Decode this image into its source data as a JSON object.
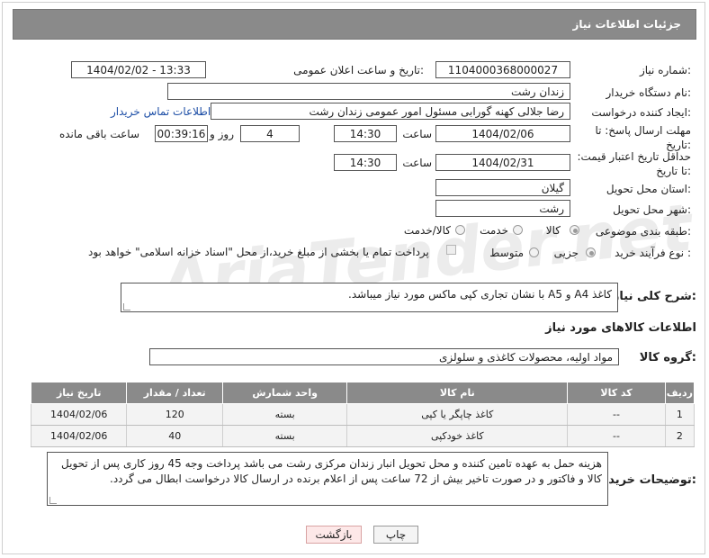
{
  "header": {
    "title": "جزئیات اطلاعات نیاز"
  },
  "fields": {
    "need_number_label": "شماره نیاز:",
    "need_number": "1104000368000027",
    "announce_label": "تاریخ و ساعت اعلان عمومی:",
    "announce_value": "1404/02/02 - 13:33",
    "buyer_org_label": "نام دستگاه خریدار:",
    "buyer_org": "زندان رشت",
    "requester_label": "ایجاد کننده درخواست:",
    "requester": "رضا جلالی کهنه گورابی مسئول امور عمومی زندان رشت",
    "contact_link": "اطلاعات تماس خریدار",
    "deadline_label": "مهلت ارسال پاسخ: تا تاریخ:",
    "deadline_date": "1404/02/06",
    "time_label": "ساعت",
    "deadline_time": "14:30",
    "days_value": "4",
    "days_label": "روز و",
    "remaining_time": "00:39:16",
    "remaining_label": "ساعت باقی مانده",
    "min_validity_label": "حداقل تاریخ اعتبار قیمت: تا تاریخ:",
    "validity_date": "1404/02/31",
    "validity_time": "14:30",
    "province_label": "استان محل تحویل:",
    "province": "گیلان",
    "city_label": "شهر محل تحویل:",
    "city": "رشت",
    "category_label": "طبقه بندی موضوعی:",
    "category_options": [
      "کالا",
      "خدمت",
      "کالا/خدمت"
    ],
    "process_label": "نوع فرآیند خرید :",
    "process_options": [
      "جزیی",
      "متوسط"
    ],
    "payment_note": "پرداخت تمام یا بخشی از مبلغ خرید،از محل \"اسناد خزانه اسلامی\" خواهد بود."
  },
  "description": {
    "label": "شرح کلی نیاز:",
    "text": "کاغذ A4 و A5 با نشان تجاری کپی ماکس  مورد نیاز میباشد."
  },
  "goods": {
    "section_title": "اطلاعات کالاهای مورد نیاز",
    "group_label": "گروه کالا:",
    "group_value": "مواد اولیه، محصولات کاغذی و سلولزی",
    "columns": [
      "ردیف",
      "کد کالا",
      "نام کالا",
      "واحد شمارش",
      "تعداد / مقدار",
      "تاریخ نیاز"
    ],
    "rows": [
      [
        "1",
        "--",
        "کاغذ چاپگر یا کپی",
        "بسته",
        "120",
        "1404/02/06"
      ],
      [
        "2",
        "--",
        "کاغذ خودکپی",
        "بسته",
        "40",
        "1404/02/06"
      ]
    ]
  },
  "buyer_notes": {
    "label": "توضیحات خریدار:",
    "text": "هزینه حمل به عهده تامین کننده و محل تحویل انبار زندان مرکزی رشت می باشد پرداخت وجه 45 روز کاری پس از تحویل کالا و فاکتور و در صورت تاخیر بیش از 72 ساعت پس از اعلام برنده در ارسال کالا درخواست ابطال می گردد."
  },
  "buttons": {
    "print": "چاپ",
    "back": "بازگشت"
  },
  "watermark": "AriaTender.net"
}
